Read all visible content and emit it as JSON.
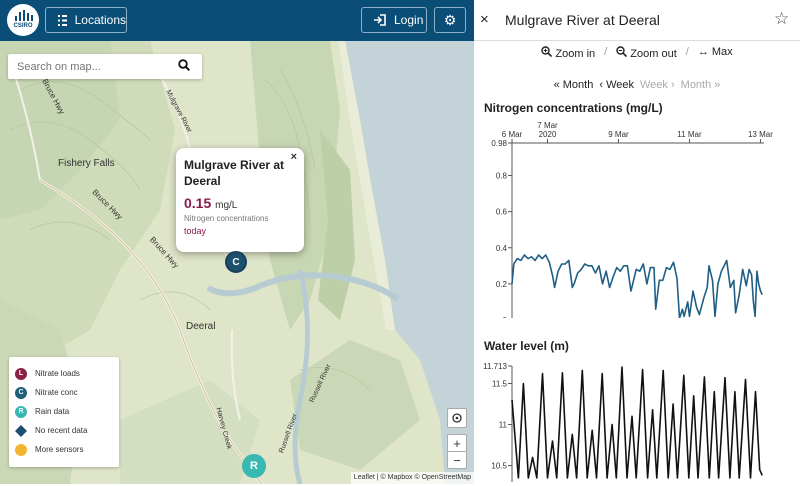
{
  "header": {
    "logo_text": "CSIRO",
    "locations_label": "Locations",
    "login_label": "Login"
  },
  "search": {
    "placeholder": "Search on map..."
  },
  "map_labels": {
    "fishery_falls": "Fishery Falls",
    "deeral": "Deeral",
    "bruce_hwy_1": "Bruce Hwy",
    "bruce_hwy_2": "Bruce Hwy",
    "bruce_hwy_3": "Bruce Hwy",
    "mulgrave_river": "Mulgrave River",
    "russell_river": "Russell River",
    "harvey_creek": "Harvey Creek",
    "attribution": "Leaflet | © Mapbox © OpenStreetMap"
  },
  "popup": {
    "title": "Mulgrave River at Deeral",
    "value": "0.15",
    "unit": "mg/L",
    "metric": "Nitrogen concentrations",
    "when": "today",
    "close": "×"
  },
  "markers": {
    "conc": "C",
    "rain": "R"
  },
  "legend": [
    {
      "label": "Nitrate loads",
      "symbol": "L",
      "color": "#8b2244"
    },
    {
      "label": "Nitrate conc",
      "symbol": "C",
      "color": "#1f5f78"
    },
    {
      "label": "Rain data",
      "symbol": "R",
      "color": "#37b8b0"
    },
    {
      "label": "No recent data",
      "symbol": "",
      "color": "#1d4f6e"
    },
    {
      "label": "More sensors",
      "symbol": "",
      "color": "#f2b530"
    }
  ],
  "controls": {
    "zoom_in": "+",
    "zoom_out": "−"
  },
  "panel": {
    "title": "Mulgrave River at Deeral",
    "close": "×",
    "star": "☆",
    "zoom_in": "Zoom in",
    "zoom_out": "Zoom out",
    "max": "Max",
    "sep": "/",
    "nav": {
      "month_back": "Month",
      "week_back": "Week",
      "week_fwd": "Week",
      "month_fwd": "Month"
    }
  },
  "colors": {
    "brand": "#0a4d77",
    "accent": "#8b1a4e",
    "series_nitrogen": "#1f5f86",
    "series_water": "#111111"
  },
  "chart_data": [
    {
      "type": "line",
      "title": "Nitrogen concentrations (mg/L)",
      "xlabel": "",
      "ylabel": "",
      "ylim": [
        0,
        0.98
      ],
      "yticks": [
        "0",
        "0.2",
        "0.4",
        "0.6",
        "0.8",
        "0.98"
      ],
      "xticks": [
        {
          "label": "6 Mar",
          "x": 0
        },
        {
          "label": "7 Mar",
          "sublabel": "2020",
          "x": 1
        },
        {
          "label": "9 Mar",
          "x": 3
        },
        {
          "label": "11 Mar",
          "x": 5
        },
        {
          "label": "13 Mar",
          "x": 7
        }
      ],
      "xlim": [
        0,
        7.1
      ],
      "series": [
        {
          "values": [
            [
              0.0,
              0.2
            ],
            [
              0.05,
              0.31
            ],
            [
              0.15,
              0.34
            ],
            [
              0.25,
              0.33
            ],
            [
              0.35,
              0.36
            ],
            [
              0.45,
              0.34
            ],
            [
              0.55,
              0.35
            ],
            [
              0.65,
              0.33
            ],
            [
              0.75,
              0.36
            ],
            [
              0.85,
              0.34
            ],
            [
              0.95,
              0.36
            ],
            [
              1.05,
              0.32
            ],
            [
              1.15,
              0.24
            ],
            [
              1.2,
              0.18
            ],
            [
              1.3,
              0.27
            ],
            [
              1.4,
              0.31
            ],
            [
              1.5,
              0.31
            ],
            [
              1.6,
              0.33
            ],
            [
              1.7,
              0.18
            ],
            [
              1.75,
              0.2
            ],
            [
              1.85,
              0.26
            ],
            [
              1.95,
              0.28
            ],
            [
              2.05,
              0.31
            ],
            [
              2.15,
              0.3
            ],
            [
              2.25,
              0.3
            ],
            [
              2.35,
              0.26
            ],
            [
              2.45,
              0.3
            ],
            [
              2.55,
              0.2
            ],
            [
              2.65,
              0.27
            ],
            [
              2.75,
              0.18
            ],
            [
              2.85,
              0.24
            ],
            [
              2.95,
              0.29
            ],
            [
              3.05,
              0.27
            ],
            [
              3.15,
              0.3
            ],
            [
              3.25,
              0.3
            ],
            [
              3.35,
              0.16
            ],
            [
              3.4,
              0.2
            ],
            [
              3.5,
              0.28
            ],
            [
              3.6,
              0.27
            ],
            [
              3.7,
              0.31
            ],
            [
              3.8,
              0.2
            ],
            [
              3.9,
              0.29
            ],
            [
              4.0,
              0.29
            ],
            [
              4.05,
              0.06
            ],
            [
              4.15,
              0.22
            ],
            [
              4.25,
              0.22
            ],
            [
              4.35,
              0.29
            ],
            [
              4.45,
              0.28
            ],
            [
              4.55,
              0.32
            ],
            [
              4.65,
              0.23
            ],
            [
              4.72,
              0.01
            ],
            [
              4.8,
              0.06
            ],
            [
              4.85,
              0.02
            ],
            [
              4.95,
              0.1
            ],
            [
              5.0,
              0.02
            ],
            [
              5.1,
              0.16
            ],
            [
              5.2,
              0.07
            ],
            [
              5.28,
              0.03
            ],
            [
              5.4,
              0.12
            ],
            [
              5.5,
              0.18
            ],
            [
              5.55,
              0.3
            ],
            [
              5.65,
              0.22
            ],
            [
              5.72,
              0.02
            ],
            [
              5.8,
              0.2
            ],
            [
              5.9,
              0.27
            ],
            [
              6.0,
              0.31
            ],
            [
              6.05,
              0.33
            ],
            [
              6.15,
              0.18
            ],
            [
              6.25,
              0.22
            ],
            [
              6.3,
              0.04
            ],
            [
              6.4,
              0.14
            ],
            [
              6.5,
              0.28
            ],
            [
              6.6,
              0.19
            ],
            [
              6.68,
              0.28
            ],
            [
              6.75,
              0.25
            ],
            [
              6.8,
              0.1
            ],
            [
              6.85,
              0.02
            ],
            [
              6.9,
              0.27
            ],
            [
              6.95,
              0.2
            ],
            [
              7.0,
              0.16
            ],
            [
              7.05,
              0.14
            ]
          ]
        }
      ]
    },
    {
      "type": "line",
      "title": "Water level (m)",
      "xlabel": "",
      "ylabel": "",
      "ylim": [
        10.3,
        11.713
      ],
      "yticks": [
        "10.5",
        "11",
        "11.5",
        "11.713"
      ],
      "xlim": [
        0,
        7.1
      ],
      "series": [
        {
          "values": [
            [
              0.0,
              11.3
            ],
            [
              0.18,
              10.35
            ],
            [
              0.32,
              11.5
            ],
            [
              0.46,
              10.35
            ],
            [
              0.58,
              10.6
            ],
            [
              0.7,
              10.35
            ],
            [
              0.86,
              11.62
            ],
            [
              1.0,
              10.35
            ],
            [
              1.14,
              10.8
            ],
            [
              1.26,
              10.35
            ],
            [
              1.42,
              11.63
            ],
            [
              1.56,
              10.35
            ],
            [
              1.7,
              10.88
            ],
            [
              1.82,
              10.35
            ],
            [
              1.98,
              11.66
            ],
            [
              2.12,
              10.35
            ],
            [
              2.26,
              10.93
            ],
            [
              2.38,
              10.35
            ],
            [
              2.54,
              11.62
            ],
            [
              2.68,
              10.35
            ],
            [
              2.82,
              11.0
            ],
            [
              2.94,
              10.35
            ],
            [
              3.1,
              11.7
            ],
            [
              3.24,
              10.35
            ],
            [
              3.38,
              11.1
            ],
            [
              3.5,
              10.35
            ],
            [
              3.68,
              11.67
            ],
            [
              3.82,
              10.35
            ],
            [
              3.96,
              11.18
            ],
            [
              4.08,
              10.35
            ],
            [
              4.26,
              11.66
            ],
            [
              4.4,
              10.35
            ],
            [
              4.54,
              11.25
            ],
            [
              4.66,
              10.35
            ],
            [
              4.84,
              11.6
            ],
            [
              4.98,
              10.35
            ],
            [
              5.12,
              11.35
            ],
            [
              5.24,
              10.35
            ],
            [
              5.42,
              11.58
            ],
            [
              5.56,
              10.35
            ],
            [
              5.7,
              11.4
            ],
            [
              5.82,
              10.35
            ],
            [
              6.0,
              11.57
            ],
            [
              6.14,
              10.35
            ],
            [
              6.28,
              11.4
            ],
            [
              6.4,
              10.35
            ],
            [
              6.58,
              11.55
            ],
            [
              6.72,
              10.35
            ],
            [
              6.86,
              11.4
            ],
            [
              6.98,
              10.45
            ],
            [
              7.05,
              10.38
            ]
          ]
        }
      ]
    }
  ]
}
